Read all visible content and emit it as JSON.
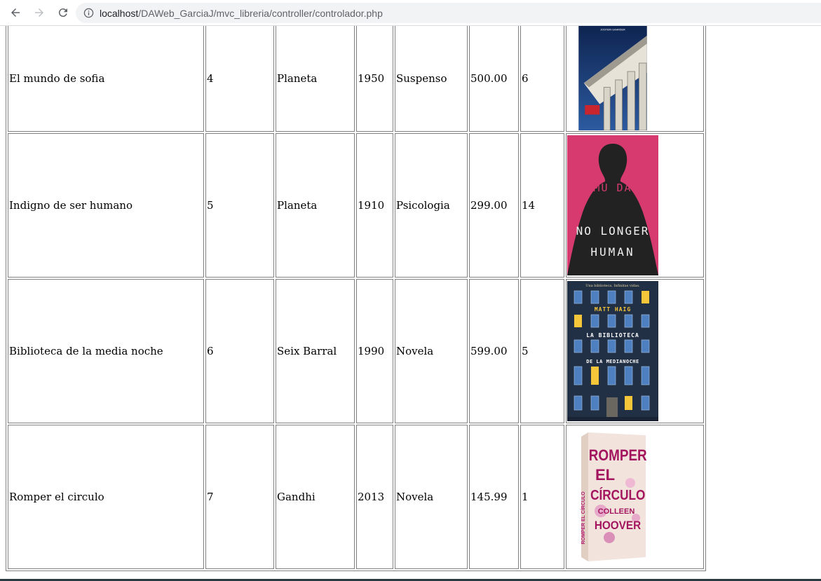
{
  "browser": {
    "url_host": "localhost",
    "url_path": "/DAWeb_GarciaJ/mvc_libreria/controller/controlador.php"
  },
  "books": [
    {
      "title": "El mundo de sofia",
      "id": "4",
      "editorial": "Planeta",
      "year": "1950",
      "genre": "Suspenso",
      "price": "500.00",
      "stock": "6",
      "cover": {
        "author": "JOSTEIN GAARDER",
        "bg": "#1d3a6b"
      }
    },
    {
      "title": "Indigno de ser humano",
      "id": "5",
      "editorial": "Planeta",
      "year": "1910",
      "genre": "Psicologia",
      "price": "299.00",
      "stock": "14",
      "cover": {
        "author": "OSAMU DAZAI",
        "line1": "NO LONGER",
        "line2": "HUMAN",
        "bg": "#d63a6e"
      }
    },
    {
      "title": "Biblioteca de la media noche",
      "id": "6",
      "editorial": "Seix Barral",
      "year": "1990",
      "genre": "Novela",
      "price": "599.00",
      "stock": "5",
      "cover": {
        "tagline": "Una biblioteca. Infinitas vidas.",
        "author": "MATT HAIG",
        "line1": "LA BIBLIOTECA",
        "line2": "DE LA MEDIANOCHE",
        "bg": "#223046"
      }
    },
    {
      "title": "Romper el circulo",
      "id": "7",
      "editorial": "Gandhi",
      "year": "2013",
      "genre": "Novela",
      "price": "145.99",
      "stock": "1",
      "cover": {
        "line1": "ROMPER",
        "line2": "EL",
        "line3": "CÍRCULO",
        "author1": "COLLEEN",
        "author2": "HOOVER",
        "spine": "ROMPER EL CÍRCULO",
        "bg": "#f2e4dc"
      }
    }
  ]
}
